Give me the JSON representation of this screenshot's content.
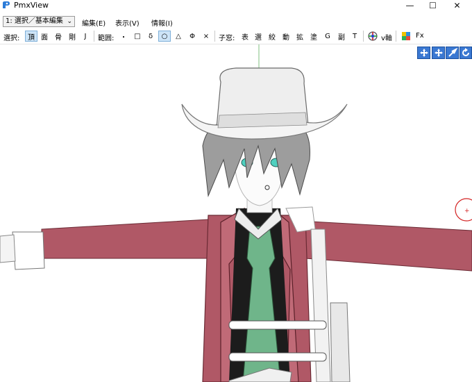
{
  "window": {
    "title": "PmxView",
    "controls": [
      "—",
      "☐",
      "✕"
    ]
  },
  "menubar": {
    "mode_selected": "1: 選択／基本編集",
    "menus": [
      "編集(E)",
      "表示(V)",
      "情報(I)"
    ]
  },
  "toolbar": {
    "select_label": "選択:",
    "select_buttons": [
      "頂",
      "面",
      "骨",
      "剛",
      "J"
    ],
    "range_label": "範囲:",
    "range_buttons": [
      "・",
      "□",
      "δ",
      "○",
      "△",
      "Φ",
      "×"
    ],
    "subwindow_label": "子窓:",
    "subwindow_buttons": [
      "表",
      "選",
      "絞",
      "動",
      "拡",
      "塗",
      "G",
      "副",
      "T"
    ],
    "axis_label": "v軸",
    "fx_label": "Fx"
  },
  "viewport_nav": {
    "icons": [
      "move-xy-icon",
      "move-xz-icon",
      "zoom-icon",
      "rotate-icon"
    ]
  },
  "colors": {
    "accent": "#3a78d2",
    "active_button_bg": "#cde4f7",
    "jacket": "#b05866",
    "tie": "#6fb58a",
    "gizmo": "#d32222"
  }
}
